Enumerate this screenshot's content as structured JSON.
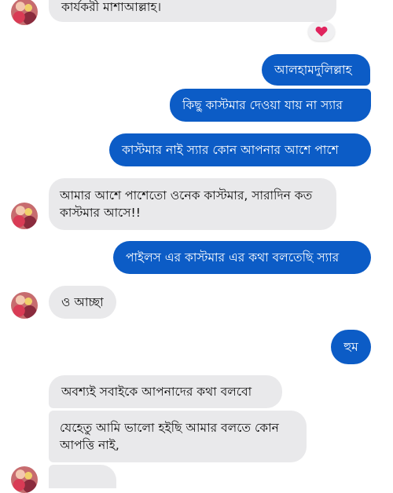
{
  "messages": {
    "m1": "কার্যকরী মাশাআল্লাহ।",
    "m2": "আলহামদুলিল্লাহ",
    "m3": "কিছু কাস্টমার দেওয়া যায় না স্যার",
    "m4": "কাস্টমার নাই স্যার কোন আপনার আশে পাশে",
    "m5": "আমার আশে পাশেতো ওনেক কাস্টমার, সারাদিন কত কাস্টমার আসে!!",
    "m6": "পাইলস এর কাস্টমার এর কথা বলতেছি স্যার",
    "m7": "ও আচ্ছা",
    "m8": "হুম",
    "m9": "অবশ্যই সবাইকে আপনাদের কথা বলবো",
    "m10": "যেহেতু আমি ভালো হইছি আমার বলতে কোন আপত্তি নাই,"
  },
  "reaction": {
    "icon": "heart-icon",
    "color": "#e0245e"
  },
  "colors": {
    "incoming_bg": "#e9e9eb",
    "outgoing_bg": "#0c5cc6"
  }
}
